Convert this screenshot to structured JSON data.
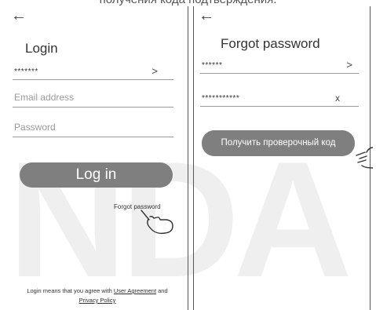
{
  "caption": "получения кода подтверждения.",
  "watermark": "NDA",
  "left_screen": {
    "back_icon": "←",
    "title": "Login",
    "account_value": "*******",
    "account_arrow": ">",
    "email_placeholder": "Email address",
    "password_placeholder": "Password",
    "login_button": "Log in",
    "forgot_link": "Forgot password",
    "legal_prefix": "Login means that you agree with",
    "user_agreement": "User Agreement",
    "legal_and": "and",
    "privacy_policy": "Privacy Policy"
  },
  "right_screen": {
    "back_icon": "←",
    "title": "Forgot password",
    "account_value": "******",
    "account_arrow": ">",
    "code_value": "***********",
    "clear_icon": "x",
    "get_code_button": "Получить проверочный код"
  }
}
